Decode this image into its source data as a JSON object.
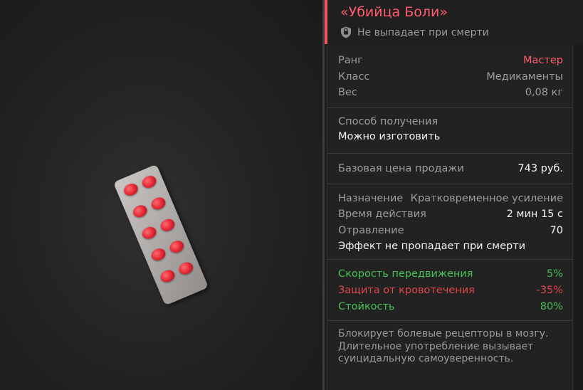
{
  "item": {
    "title": "«Убийца Боли»",
    "keep_on_death": "Не выпадает при смерти",
    "stats": [
      {
        "label": "Ранг",
        "value": "Мастер",
        "value_color": "#ff5d6b"
      },
      {
        "label": "Класс",
        "value": "Медикаменты"
      },
      {
        "label": "Вес",
        "value": "0,08 кг"
      }
    ],
    "obtain": {
      "label": "Способ получения",
      "value": "Можно изготовить"
    },
    "price": {
      "label": "Базовая цена продажи",
      "value": "743 руб."
    },
    "details": [
      {
        "label": "Назначение",
        "value": "Кратковременное усиление"
      },
      {
        "label": "Время действия",
        "value": "2 мин 15 с"
      },
      {
        "label": "Отравление",
        "value": "70"
      }
    ],
    "effect_note": "Эффект не пропадает при смерти",
    "effects": [
      {
        "label": "Скорость передвижения",
        "value": "5%",
        "color": "#44c254"
      },
      {
        "label": "Защита от кровотечения",
        "value": "-35%",
        "color": "#e0474f"
      },
      {
        "label": "Стойкость",
        "value": "80%",
        "color": "#44c254"
      }
    ],
    "description": "Блокирует болевые рецепторы в мозгу. Длительное употребление вызывает суицидальную самоуверенность."
  },
  "colors": {
    "accent": "#f05561",
    "positive": "#44c254",
    "negative": "#e0474f"
  },
  "icons": {
    "keep": "shield-icon"
  }
}
